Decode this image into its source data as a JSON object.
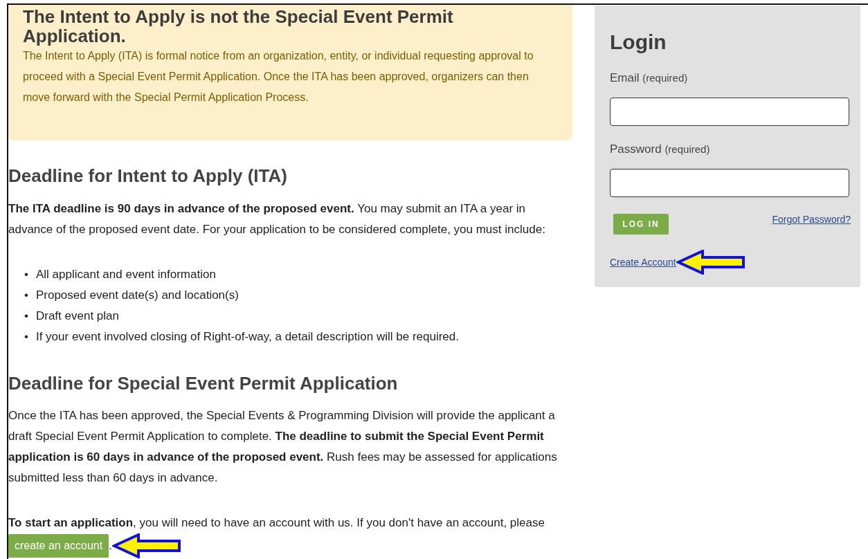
{
  "notice": {
    "title": "The Intent to Apply is not the Special Event Permit Application.",
    "body": "The Intent to Apply (ITA) is formal notice from an organization, entity, or individual requesting approval to proceed with a Special Event Permit Application. Once the ITA has been approved, organizers can then move forward with the Special Permit Application Process."
  },
  "sections": [
    {
      "heading": "Deadline for Intent to Apply (ITA)",
      "paragraphs": [
        "**The ITA deadline is 90 days in advance of the proposed event.** You may submit an ITA a year in advance of the proposed event date. For your application to be considered complete, you must include:"
      ],
      "bullets": [
        {
          "marker": "•",
          "text": "All applicant and event information"
        },
        {
          "marker": "•",
          "text": "Proposed event date(s) and location(s)"
        },
        {
          "marker": "•",
          "text": "Draft event plan"
        },
        {
          "marker": "•",
          "text": "If your event involved closing of Right-of-way, a detail description will be required."
        }
      ]
    },
    {
      "heading": "Deadline for Special Event Permit Application",
      "paragraphs": [
        "Once the ITA has been approved, the Special Events & Programming Division will provide the applicant a draft Special Event Permit Application to complete. **The deadline to submit the Special Event Permit application is 60 days in advance of the proposed event.** Rush fees may be assessed for applications submitted less than 60 days in advance.",
        "**To start an application**, you will need to have an account with us. If you don't have an account, please"
      ]
    }
  ],
  "start_button": {
    "label": "create an account",
    "after": "."
  },
  "login": {
    "title": "Login",
    "fields": [
      {
        "label": "Email",
        "hint": "(required)"
      },
      {
        "label": "Password",
        "hint": "(required)"
      }
    ],
    "login_button": "LOG IN",
    "forgot_link": "Forgot Password?",
    "create_link": "Create Account"
  }
}
